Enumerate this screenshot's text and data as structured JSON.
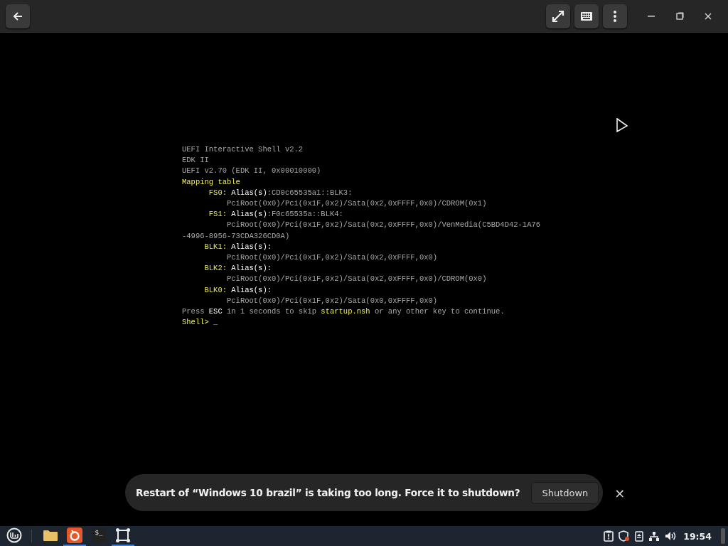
{
  "console": {
    "lines": [
      {
        "kind": "text",
        "segments": [
          {
            "kind": "normal",
            "text": "UEFI Interactive Shell v2.2"
          }
        ]
      },
      {
        "kind": "text",
        "segments": [
          {
            "kind": "normal",
            "text": "EDK II"
          }
        ]
      },
      {
        "kind": "text",
        "segments": [
          {
            "kind": "normal",
            "text": "UEFI v2.70 (EDK II, 0x00010000)"
          }
        ]
      },
      {
        "kind": "text",
        "segments": [
          {
            "kind": "highlight",
            "text": "Mapping table"
          }
        ]
      },
      {
        "kind": "entry",
        "label": "FS0:",
        "segments": [
          {
            "kind": "bright",
            "text": "Alias(s)"
          },
          {
            "kind": "normal",
            "text": ":CD0c65535a1::BLK3:"
          }
        ]
      },
      {
        "kind": "path",
        "segments": [
          {
            "kind": "normal",
            "text": "PciRoot(0x0)/Pci(0x1F,0x2)/Sata(0x2,0xFFFF,0x0)/CDROM(0x1)"
          }
        ]
      },
      {
        "kind": "entry",
        "label": "FS1:",
        "segments": [
          {
            "kind": "bright",
            "text": "Alias(s)"
          },
          {
            "kind": "normal",
            "text": ":F0c65535a::BLK4:"
          }
        ]
      },
      {
        "kind": "path",
        "segments": [
          {
            "kind": "normal",
            "text": "PciRoot(0x0)/Pci(0x1F,0x2)/Sata(0x2,0xFFFF,0x0)/VenMedia(C5BD4D42-1A76"
          }
        ]
      },
      {
        "kind": "text",
        "segments": [
          {
            "kind": "normal",
            "text": "-4996-8956-73CDA326CD0A)"
          }
        ]
      },
      {
        "kind": "entry",
        "label": "BLK1:",
        "segments": [
          {
            "kind": "bright",
            "text": "Alias(s):"
          }
        ]
      },
      {
        "kind": "path",
        "segments": [
          {
            "kind": "normal",
            "text": "PciRoot(0x0)/Pci(0x1F,0x2)/Sata(0x2,0xFFFF,0x0)"
          }
        ]
      },
      {
        "kind": "entry",
        "label": "BLK2:",
        "segments": [
          {
            "kind": "bright",
            "text": "Alias(s):"
          }
        ]
      },
      {
        "kind": "path",
        "segments": [
          {
            "kind": "normal",
            "text": "PciRoot(0x0)/Pci(0x1F,0x2)/Sata(0x2,0xFFFF,0x0)/CDROM(0x0)"
          }
        ]
      },
      {
        "kind": "entry",
        "label": "BLK0:",
        "segments": [
          {
            "kind": "bright",
            "text": "Alias(s):"
          }
        ]
      },
      {
        "kind": "path",
        "segments": [
          {
            "kind": "normal",
            "text": "PciRoot(0x0)/Pci(0x1F,0x2)/Sata(0x0,0xFFFF,0x0)"
          }
        ]
      },
      {
        "kind": "text",
        "segments": [
          {
            "kind": "normal",
            "text": "Press "
          },
          {
            "kind": "bright",
            "text": "ESC"
          },
          {
            "kind": "normal",
            "text": " in 1 seconds to skip "
          },
          {
            "kind": "highlight",
            "text": "startup.nsh"
          },
          {
            "kind": "normal",
            "text": " or any other key to continue."
          }
        ]
      },
      {
        "kind": "text",
        "segments": [
          {
            "kind": "highlight",
            "text": "Shell> "
          },
          {
            "kind": "normal",
            "text": "_"
          }
        ]
      }
    ]
  },
  "notification": {
    "message": "Restart of “Windows 10 brazil” is taking too long. Force it to shutdown?",
    "action": "Shutdown",
    "close": "×"
  },
  "taskbar": {
    "launchers": [
      {
        "kind": "folder",
        "running": false
      },
      {
        "kind": "browser",
        "running": true
      },
      {
        "kind": "terminal",
        "label": "$_",
        "running": false
      },
      {
        "kind": "window",
        "running": true
      }
    ],
    "clock": "19:54"
  }
}
